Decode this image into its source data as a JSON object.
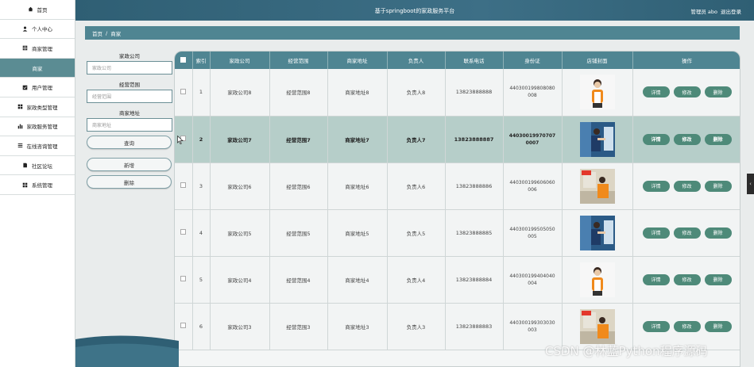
{
  "header": {
    "title": "基于springboot的家政服务平台",
    "user_label": "管理员 abo",
    "logout_label": "退出登录"
  },
  "sidebar": {
    "items": [
      {
        "label": "首页",
        "icon": "home-icon"
      },
      {
        "label": "个人中心",
        "icon": "user-icon"
      },
      {
        "label": "商家管理",
        "icon": "table-icon"
      },
      {
        "label": "商家",
        "icon": ""
      },
      {
        "label": "用户管理",
        "icon": "check-icon"
      },
      {
        "label": "家政类型管理",
        "icon": "grid-icon"
      },
      {
        "label": "家政服务管理",
        "icon": "bar-icon"
      },
      {
        "label": "在线咨询管理",
        "icon": "list-icon"
      },
      {
        "label": "社区论坛",
        "icon": "file-icon"
      },
      {
        "label": "系统管理",
        "icon": "grid-icon"
      }
    ]
  },
  "breadcrumb": {
    "home": "首页",
    "sep": "/",
    "current": "商家"
  },
  "filters": {
    "company_label": "家政公司",
    "company_placeholder": "家政公司",
    "scope_label": "经营范围",
    "scope_placeholder": "经营范围",
    "address_label": "商家地址",
    "address_placeholder": "商家地址",
    "search_button": "查询",
    "add_button": "新增",
    "delete_button": "删除"
  },
  "table": {
    "headers": [
      "",
      "索引",
      "家政公司",
      "经营范围",
      "商家地址",
      "负责人",
      "联系电话",
      "身份证",
      "店铺封面",
      "操作"
    ],
    "actions": {
      "detail": "详情",
      "edit": "修改",
      "delete": "删除"
    },
    "rows": [
      {
        "index": "1",
        "company": "家政公司8",
        "scope": "经营范围8",
        "address": "商家地址8",
        "manager": "负责人8",
        "phone": "13823888888",
        "id": "440300199808080008",
        "highlight": false
      },
      {
        "index": "2",
        "company": "家政公司7",
        "scope": "经营范围7",
        "address": "商家地址7",
        "manager": "负责人7",
        "phone": "13823888887",
        "id": "440300199707070007",
        "highlight": true
      },
      {
        "index": "3",
        "company": "家政公司6",
        "scope": "经营范围6",
        "address": "商家地址6",
        "manager": "负责人6",
        "phone": "13823888886",
        "id": "440300199606060006",
        "highlight": false
      },
      {
        "index": "4",
        "company": "家政公司5",
        "scope": "经营范围5",
        "address": "商家地址5",
        "manager": "负责人5",
        "phone": "13823888885",
        "id": "440300199505050005",
        "highlight": false
      },
      {
        "index": "5",
        "company": "家政公司4",
        "scope": "经营范围4",
        "address": "商家地址4",
        "manager": "负责人4",
        "phone": "13823888884",
        "id": "440300199404040004",
        "highlight": false
      },
      {
        "index": "6",
        "company": "家政公司3",
        "scope": "经营范围3",
        "address": "商家地址3",
        "manager": "负责人3",
        "phone": "13823888883",
        "id": "440300199303030003",
        "highlight": false
      }
    ]
  },
  "watermark": "CSDN @林蓝Python程序源码",
  "colors": {
    "header": "#2f5f74",
    "accent": "#4f8592",
    "action_button": "#4e8a79",
    "highlight_row": "#b6cec9"
  }
}
